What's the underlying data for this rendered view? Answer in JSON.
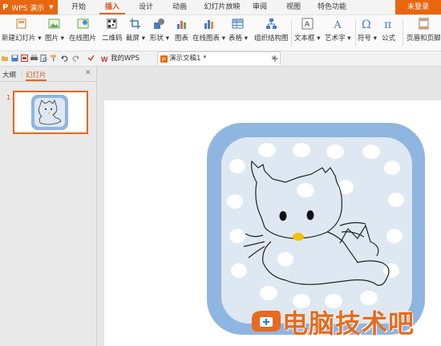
{
  "app": {
    "logo": "P",
    "name": "WPS 演示"
  },
  "tabs": [
    {
      "label": "开始"
    },
    {
      "label": "插入"
    },
    {
      "label": "设计"
    },
    {
      "label": "动画"
    },
    {
      "label": "幻灯片放映"
    },
    {
      "label": "审阅"
    },
    {
      "label": "视图"
    },
    {
      "label": "特色功能"
    }
  ],
  "account": {
    "login_label": "未登录"
  },
  "ribbon": {
    "items": [
      {
        "label": "新建幻灯片 ▾",
        "icon": "new-slide-icon"
      },
      {
        "label": "图片 ▾",
        "icon": "picture-icon"
      },
      {
        "label": "在线图片",
        "icon": "online-picture-icon"
      },
      {
        "label": "二维码",
        "icon": "qrcode-icon"
      },
      {
        "label": "截屏 ▾",
        "icon": "screenshot-icon"
      },
      {
        "label": "形状 ▾",
        "icon": "shape-icon"
      },
      {
        "label": "图表",
        "icon": "chart-icon"
      },
      {
        "label": "在线图表 ▾",
        "icon": "online-chart-icon"
      },
      {
        "label": "表格 ▾",
        "icon": "table-icon"
      },
      {
        "label": "组织结构图",
        "icon": "org-chart-icon"
      },
      {
        "label": "文本框 ▾",
        "icon": "textbox-icon"
      },
      {
        "label": "艺术字 ▾",
        "icon": "wordart-icon"
      },
      {
        "label": "符号 ▾",
        "icon": "symbol-icon"
      },
      {
        "label": "公式",
        "icon": "formula-icon"
      },
      {
        "label": "页眉和页脚",
        "icon": "header-footer-icon"
      }
    ]
  },
  "document_tabs": [
    {
      "label": "我的WPS"
    },
    {
      "label": "演示文稿1 *"
    }
  ],
  "panel": {
    "tabs": [
      {
        "label": "大纲"
      },
      {
        "label": "幻灯片"
      }
    ],
    "slide_number": "1"
  },
  "watermark": {
    "text": "电脑技术吧"
  },
  "colors": {
    "accent": "#e8660f",
    "frame": "#8fb6e0",
    "frame_inner": "#dde8f2"
  }
}
